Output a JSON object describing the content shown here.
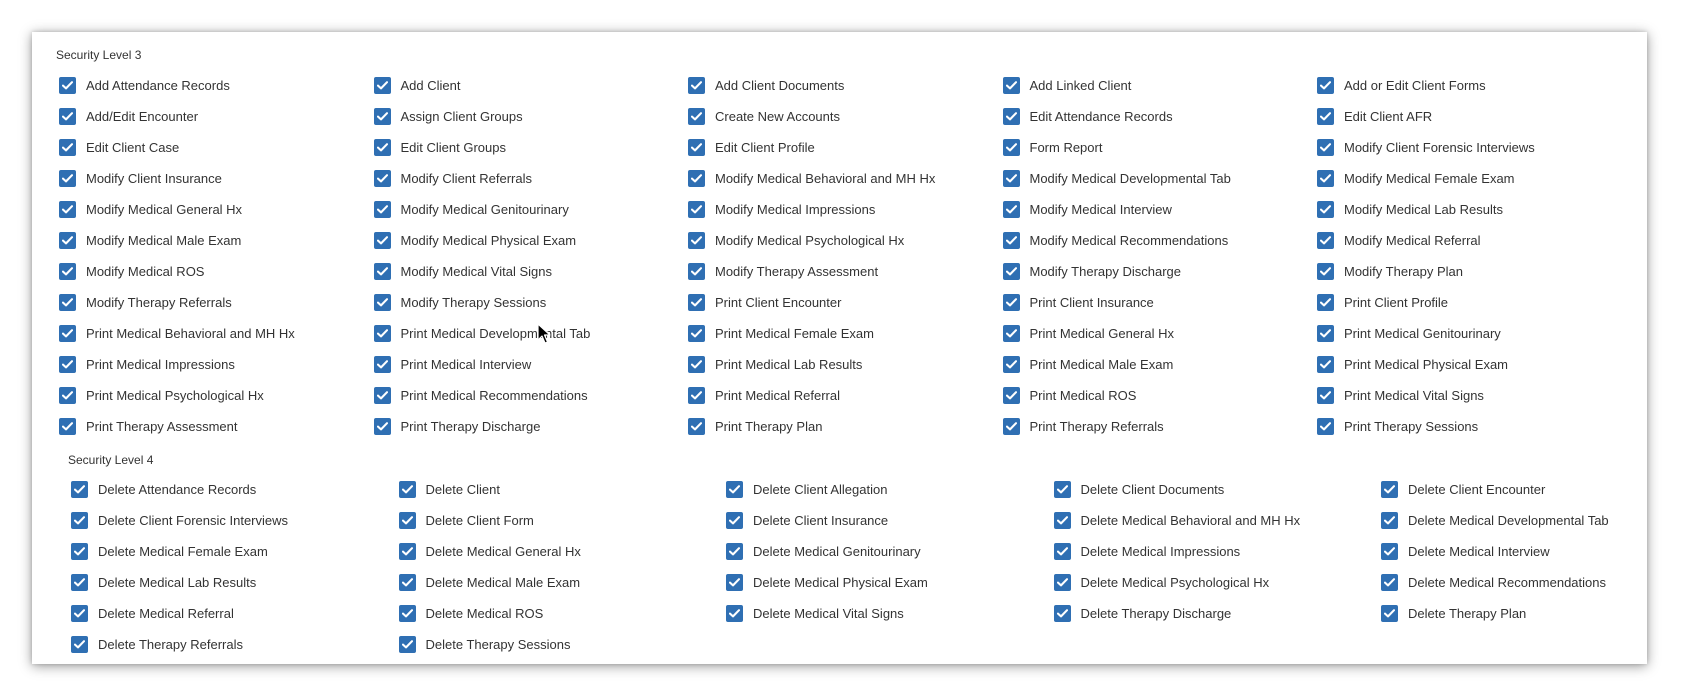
{
  "colors": {
    "checkbox_fill": "#2f6fb3",
    "checkmark": "#ffffff",
    "text": "#333333"
  },
  "sections": [
    {
      "title": "Security Level 3",
      "items": [
        {
          "label": "Add Attendance Records",
          "checked": true
        },
        {
          "label": "Add Client",
          "checked": true
        },
        {
          "label": "Add Client Documents",
          "checked": true
        },
        {
          "label": "Add Linked Client",
          "checked": true
        },
        {
          "label": "Add or Edit Client Forms",
          "checked": true
        },
        {
          "label": "Add/Edit Encounter",
          "checked": true
        },
        {
          "label": "Assign Client Groups",
          "checked": true
        },
        {
          "label": "Create New Accounts",
          "checked": true
        },
        {
          "label": "Edit Attendance Records",
          "checked": true
        },
        {
          "label": "Edit Client AFR",
          "checked": true
        },
        {
          "label": "Edit Client Case",
          "checked": true
        },
        {
          "label": "Edit Client Groups",
          "checked": true
        },
        {
          "label": "Edit Client Profile",
          "checked": true
        },
        {
          "label": "Form Report",
          "checked": true
        },
        {
          "label": "Modify Client Forensic Interviews",
          "checked": true
        },
        {
          "label": "Modify Client Insurance",
          "checked": true
        },
        {
          "label": "Modify Client Referrals",
          "checked": true
        },
        {
          "label": "Modify Medical Behavioral and MH Hx",
          "checked": true
        },
        {
          "label": "Modify Medical Developmental Tab",
          "checked": true
        },
        {
          "label": "Modify Medical Female Exam",
          "checked": true
        },
        {
          "label": "Modify Medical General Hx",
          "checked": true
        },
        {
          "label": "Modify Medical Genitourinary",
          "checked": true
        },
        {
          "label": "Modify Medical Impressions",
          "checked": true
        },
        {
          "label": "Modify Medical Interview",
          "checked": true
        },
        {
          "label": "Modify Medical Lab Results",
          "checked": true
        },
        {
          "label": "Modify Medical Male Exam",
          "checked": true
        },
        {
          "label": "Modify Medical Physical Exam",
          "checked": true
        },
        {
          "label": "Modify Medical Psychological Hx",
          "checked": true
        },
        {
          "label": "Modify Medical Recommendations",
          "checked": true
        },
        {
          "label": "Modify Medical Referral",
          "checked": true
        },
        {
          "label": "Modify Medical ROS",
          "checked": true
        },
        {
          "label": "Modify Medical Vital Signs",
          "checked": true
        },
        {
          "label": "Modify Therapy Assessment",
          "checked": true
        },
        {
          "label": "Modify Therapy Discharge",
          "checked": true
        },
        {
          "label": "Modify Therapy Plan",
          "checked": true
        },
        {
          "label": "Modify Therapy Referrals",
          "checked": true
        },
        {
          "label": "Modify Therapy Sessions",
          "checked": true
        },
        {
          "label": "Print Client Encounter",
          "checked": true
        },
        {
          "label": "Print Client Insurance",
          "checked": true
        },
        {
          "label": "Print Client Profile",
          "checked": true
        },
        {
          "label": "Print Medical Behavioral and MH Hx",
          "checked": true
        },
        {
          "label": "Print Medical Developmental Tab",
          "checked": true
        },
        {
          "label": "Print Medical Female Exam",
          "checked": true
        },
        {
          "label": "Print Medical General Hx",
          "checked": true
        },
        {
          "label": "Print Medical Genitourinary",
          "checked": true
        },
        {
          "label": "Print Medical Impressions",
          "checked": true
        },
        {
          "label": "Print Medical Interview",
          "checked": true
        },
        {
          "label": "Print Medical Lab Results",
          "checked": true
        },
        {
          "label": "Print Medical Male Exam",
          "checked": true
        },
        {
          "label": "Print Medical Physical Exam",
          "checked": true
        },
        {
          "label": "Print Medical Psychological Hx",
          "checked": true
        },
        {
          "label": "Print Medical Recommendations",
          "checked": true
        },
        {
          "label": "Print Medical Referral",
          "checked": true
        },
        {
          "label": "Print Medical ROS",
          "checked": true
        },
        {
          "label": "Print Medical Vital Signs",
          "checked": true
        },
        {
          "label": "Print Therapy Assessment",
          "checked": true
        },
        {
          "label": "Print Therapy Discharge",
          "checked": true
        },
        {
          "label": "Print Therapy Plan",
          "checked": true
        },
        {
          "label": "Print Therapy Referrals",
          "checked": true
        },
        {
          "label": "Print Therapy Sessions",
          "checked": true
        }
      ]
    },
    {
      "title": "Security Level 4",
      "items": [
        {
          "label": "Delete Attendance Records",
          "checked": true
        },
        {
          "label": "Delete Client",
          "checked": true
        },
        {
          "label": "Delete Client Allegation",
          "checked": true
        },
        {
          "label": "Delete Client Documents",
          "checked": true
        },
        {
          "label": "Delete Client Encounter",
          "checked": true
        },
        {
          "label": "Delete Client Forensic Interviews",
          "checked": true
        },
        {
          "label": "Delete Client Form",
          "checked": true
        },
        {
          "label": "Delete Client Insurance",
          "checked": true
        },
        {
          "label": "Delete Medical Behavioral and MH Hx",
          "checked": true
        },
        {
          "label": "Delete Medical Developmental Tab",
          "checked": true
        },
        {
          "label": "Delete Medical Female Exam",
          "checked": true
        },
        {
          "label": "Delete Medical General Hx",
          "checked": true
        },
        {
          "label": "Delete Medical Genitourinary",
          "checked": true
        },
        {
          "label": "Delete Medical Impressions",
          "checked": true
        },
        {
          "label": "Delete Medical Interview",
          "checked": true
        },
        {
          "label": "Delete Medical Lab Results",
          "checked": true
        },
        {
          "label": "Delete Medical Male Exam",
          "checked": true
        },
        {
          "label": "Delete Medical Physical Exam",
          "checked": true
        },
        {
          "label": "Delete Medical Psychological Hx",
          "checked": true
        },
        {
          "label": "Delete Medical Recommendations",
          "checked": true
        },
        {
          "label": "Delete Medical Referral",
          "checked": true
        },
        {
          "label": "Delete Medical ROS",
          "checked": true
        },
        {
          "label": "Delete Medical Vital Signs",
          "checked": true
        },
        {
          "label": "Delete Therapy Discharge",
          "checked": true
        },
        {
          "label": "Delete Therapy Plan",
          "checked": true
        },
        {
          "label": "Delete Therapy Referrals",
          "checked": true
        },
        {
          "label": "Delete Therapy Sessions",
          "checked": true
        }
      ]
    }
  ]
}
